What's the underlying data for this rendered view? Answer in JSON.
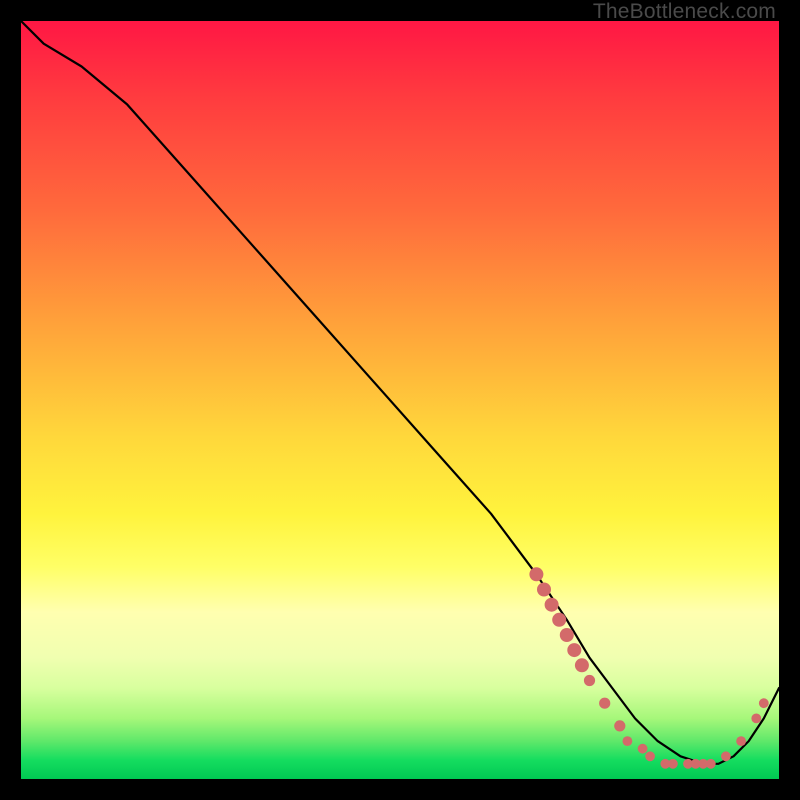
{
  "watermark": "TheBottleneck.com",
  "colors": {
    "background": "#000000",
    "curve_stroke": "#000000",
    "marker_fill": "#d36a6a",
    "gradient_top": "#ff1744",
    "gradient_bottom": "#00c853"
  },
  "chart_data": {
    "type": "line",
    "title": "",
    "xlabel": "",
    "ylabel": "",
    "xlim": [
      0,
      100
    ],
    "ylim": [
      0,
      100
    ],
    "grid": false,
    "legend": false,
    "series": [
      {
        "name": "curve",
        "x": [
          0,
          3,
          8,
          14,
          22,
          30,
          38,
          46,
          54,
          62,
          68,
          72,
          75,
          78,
          81,
          84,
          87,
          90,
          92,
          94,
          96,
          98,
          100
        ],
        "values": [
          100,
          97,
          94,
          89,
          80,
          71,
          62,
          53,
          44,
          35,
          27,
          21,
          16,
          12,
          8,
          5,
          3,
          2,
          2,
          3,
          5,
          8,
          12
        ]
      }
    ],
    "markers": [
      {
        "x": 68,
        "y": 27,
        "r": 1.0
      },
      {
        "x": 69,
        "y": 25,
        "r": 1.0
      },
      {
        "x": 70,
        "y": 23,
        "r": 1.0
      },
      {
        "x": 71,
        "y": 21,
        "r": 1.0
      },
      {
        "x": 72,
        "y": 19,
        "r": 1.0
      },
      {
        "x": 73,
        "y": 17,
        "r": 1.0
      },
      {
        "x": 74,
        "y": 15,
        "r": 1.0
      },
      {
        "x": 75,
        "y": 13,
        "r": 0.8
      },
      {
        "x": 77,
        "y": 10,
        "r": 0.8
      },
      {
        "x": 79,
        "y": 7,
        "r": 0.8
      },
      {
        "x": 80,
        "y": 5,
        "r": 0.7
      },
      {
        "x": 82,
        "y": 4,
        "r": 0.7
      },
      {
        "x": 83,
        "y": 3,
        "r": 0.7
      },
      {
        "x": 85,
        "y": 2,
        "r": 0.7
      },
      {
        "x": 86,
        "y": 2,
        "r": 0.7
      },
      {
        "x": 88,
        "y": 2,
        "r": 0.7
      },
      {
        "x": 89,
        "y": 2,
        "r": 0.7
      },
      {
        "x": 90,
        "y": 2,
        "r": 0.7
      },
      {
        "x": 91,
        "y": 2,
        "r": 0.7
      },
      {
        "x": 93,
        "y": 3,
        "r": 0.7
      },
      {
        "x": 95,
        "y": 5,
        "r": 0.7
      },
      {
        "x": 97,
        "y": 8,
        "r": 0.7
      },
      {
        "x": 98,
        "y": 10,
        "r": 0.7
      }
    ]
  }
}
